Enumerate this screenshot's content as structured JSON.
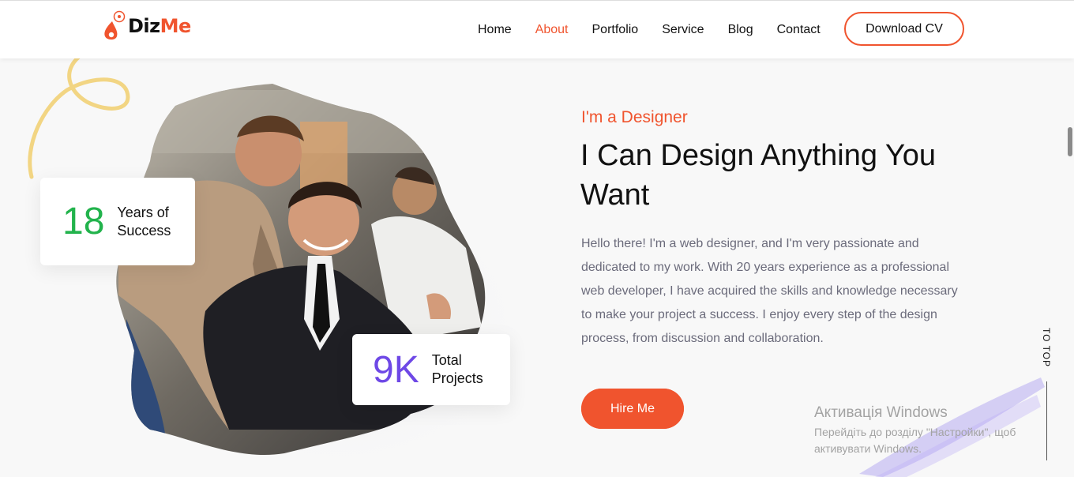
{
  "brand": {
    "name_part1": "Diz",
    "name_part2": "Me",
    "accent_color": "#f0542e"
  },
  "nav": {
    "items": [
      {
        "label": "Home",
        "active": false
      },
      {
        "label": "About",
        "active": true
      },
      {
        "label": "Portfolio",
        "active": false
      },
      {
        "label": "Service",
        "active": false
      },
      {
        "label": "Blog",
        "active": false
      },
      {
        "label": "Contact",
        "active": false
      }
    ],
    "download_cv": "Download CV"
  },
  "hero": {
    "subtitle": "I'm a Designer",
    "title": "I Can Design Anything You Want",
    "description": "Hello there! I'm a web designer, and I'm very passionate and dedicated to my work. With 20 years experience as a professional web developer, I have acquired the skills and knowledge necessary to make your project a success. I enjoy every step of the design process, from discussion and collaboration.",
    "hire_button": "Hire Me"
  },
  "stats": [
    {
      "value": "18",
      "label_line1": "Years of",
      "label_line2": "Success",
      "color": "#22b34c"
    },
    {
      "value": "9K",
      "label_line1": "Total",
      "label_line2": "Projects",
      "color": "#6e48e6"
    }
  ],
  "to_top": "TO TOP",
  "watermark": {
    "title": "Активація Windows",
    "line1": "Перейдіть до розділу \"Настройки\", щоб",
    "line2": "активувати Windows."
  }
}
